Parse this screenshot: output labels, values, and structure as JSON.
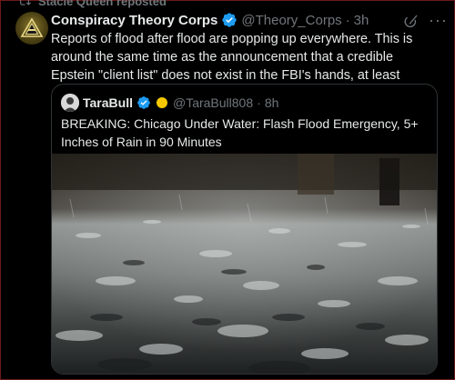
{
  "repost": {
    "label": "Stacie Queen reposted"
  },
  "post": {
    "author_name": "Conspiracy Theory Corps",
    "author_handle": "@Theory_Corps",
    "separator": "·",
    "time": "3h",
    "text": "Reports of flood after flood are popping up everywhere. This is around the same time as the announcement that a credible Epstein \"client list\" does not exist in the FBI's hands, at least anymore. Coincidence?",
    "more_label": "···"
  },
  "quote": {
    "author_name": "TaraBull",
    "author_handle": "@TaraBull808",
    "separator": "·",
    "time": "8h",
    "text": "BREAKING: Chicago Under Water: Flash Flood Emergency, 5+ Inches of Rain in 90 Minutes"
  },
  "colors": {
    "background": "#000000",
    "text": "#e7e9ea",
    "muted": "#71767b",
    "verified": "#1d9bf0",
    "border": "#2f3336"
  },
  "icons": [
    "repost-icon",
    "verified-badge-icon",
    "grok-icon",
    "more-icon"
  ]
}
